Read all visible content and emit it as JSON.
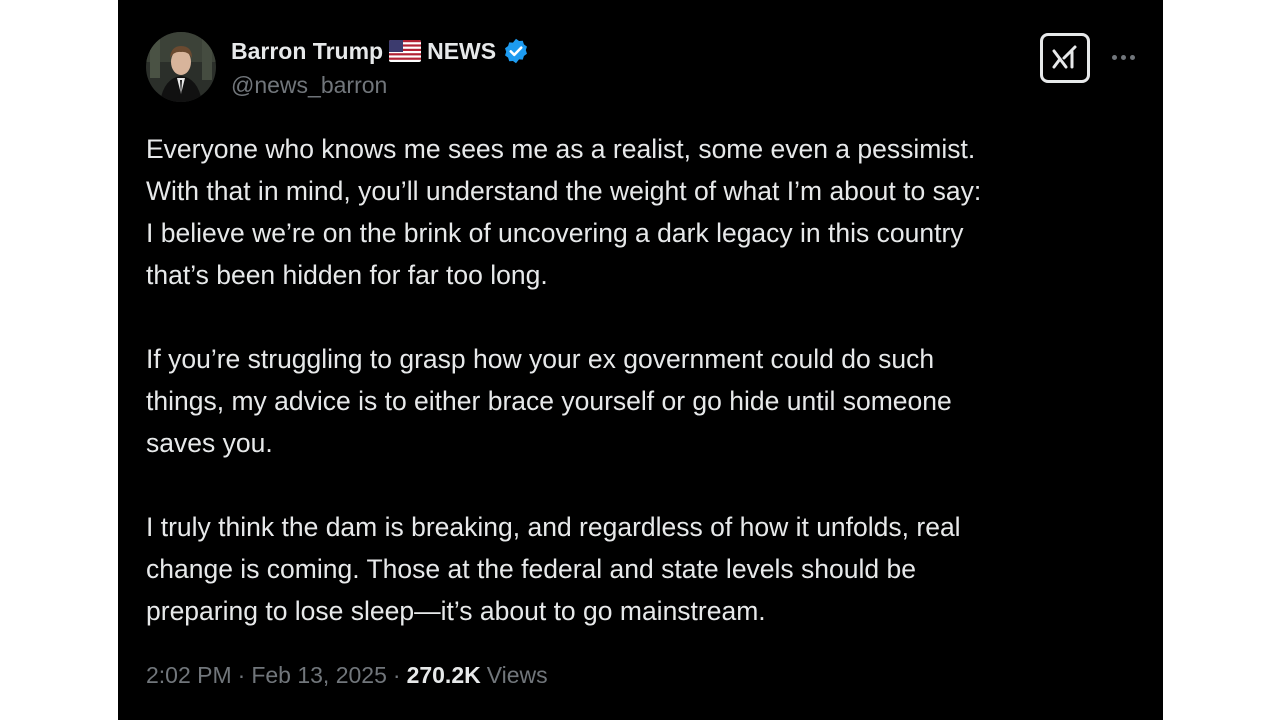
{
  "tweet": {
    "author": {
      "name": "Barron Trump",
      "name_suffix": "NEWS",
      "handle": "@news_barron",
      "avatar_icon": "profile-photo",
      "flag_icon": "us-flag-icon",
      "verified_icon": "verified-badge-icon"
    },
    "actions": {
      "grok_icon": "grok-icon",
      "more_icon": "more-dots-icon"
    },
    "paragraphs": [
      "Everyone who knows me sees me as a realist, some even a pessimist.\nWith that in mind, you’ll understand the weight of what I’m about to say:\nI believe we’re on the brink of uncovering a dark legacy in this country\nthat’s been hidden for far too long.",
      "If you’re struggling to grasp how your ex government could do such\nthings, my advice is to either brace yourself or go hide until someone\nsaves you.",
      "I truly think the dam is breaking, and regardless of how it unfolds, real\nchange is coming. Those at the federal and state levels should be\npreparing to lose sleep—it’s about to go mainstream."
    ],
    "meta": {
      "time": "2:02 PM",
      "separator": "·",
      "date": "Feb 13, 2025",
      "views_count": "270.2K",
      "views_label": "Views"
    },
    "colors": {
      "background": "#000000",
      "text": "#e7e9ea",
      "secondary": "#71767b",
      "verified": "#1d9bf0"
    }
  }
}
